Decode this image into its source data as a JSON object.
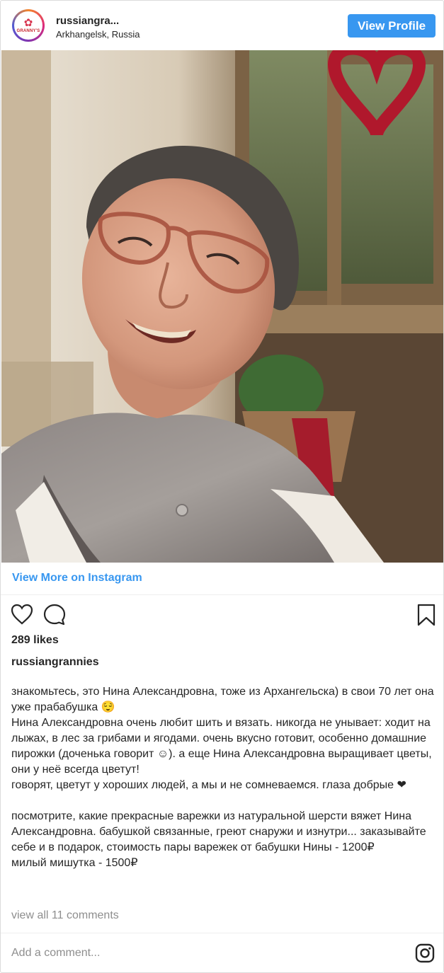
{
  "header": {
    "avatar_text": "GRANNY'S",
    "username": "russiangra...",
    "location": "Arkhangelsk, Russia",
    "view_profile_label": "View Profile"
  },
  "post": {
    "photo_alt": "",
    "view_more_label": "View More on Instagram",
    "likes": "289 likes",
    "caption_user": "russiangrannies",
    "caption_paragraphs": [
      "знакомьтесь, это Нина Александровна, тоже из Архангельска) в свои 70 лет она уже прабабушка 😌\nНина Александровна очень любит шить и вязать. никогда не унывает: ходит на лыжах, в лес за грибами и ягодами. очень вкусно готовит, особенно домашние пирожки (доченька говорит ☺). а еще Нина Александровна выращивает цветы, они у неё всегда цветут!\nговорят, цветут у хороших людей, а мы и не сомневаемся. глаза добрые ❤",
      "посмотрите, какие прекрасные варежки из натуральной шерсти вяжет Нина Александровна. бабушкой связанные, греют снаружи и изнутри... заказывайте себе и в подарок, стоимость пары варежек от бабушки Нины - 1200₽\nмилый мишутка - 1500₽"
    ],
    "view_comments": "view all 11 comments",
    "comment_placeholder": "Add a comment..."
  },
  "icons": {
    "like": "heart-icon",
    "comment": "comment-bubble-icon",
    "save": "bookmark-icon",
    "instagram": "instagram-logo-icon"
  },
  "colors": {
    "accent": "#3897f0",
    "text": "#262626",
    "muted": "#8e8e8e"
  }
}
